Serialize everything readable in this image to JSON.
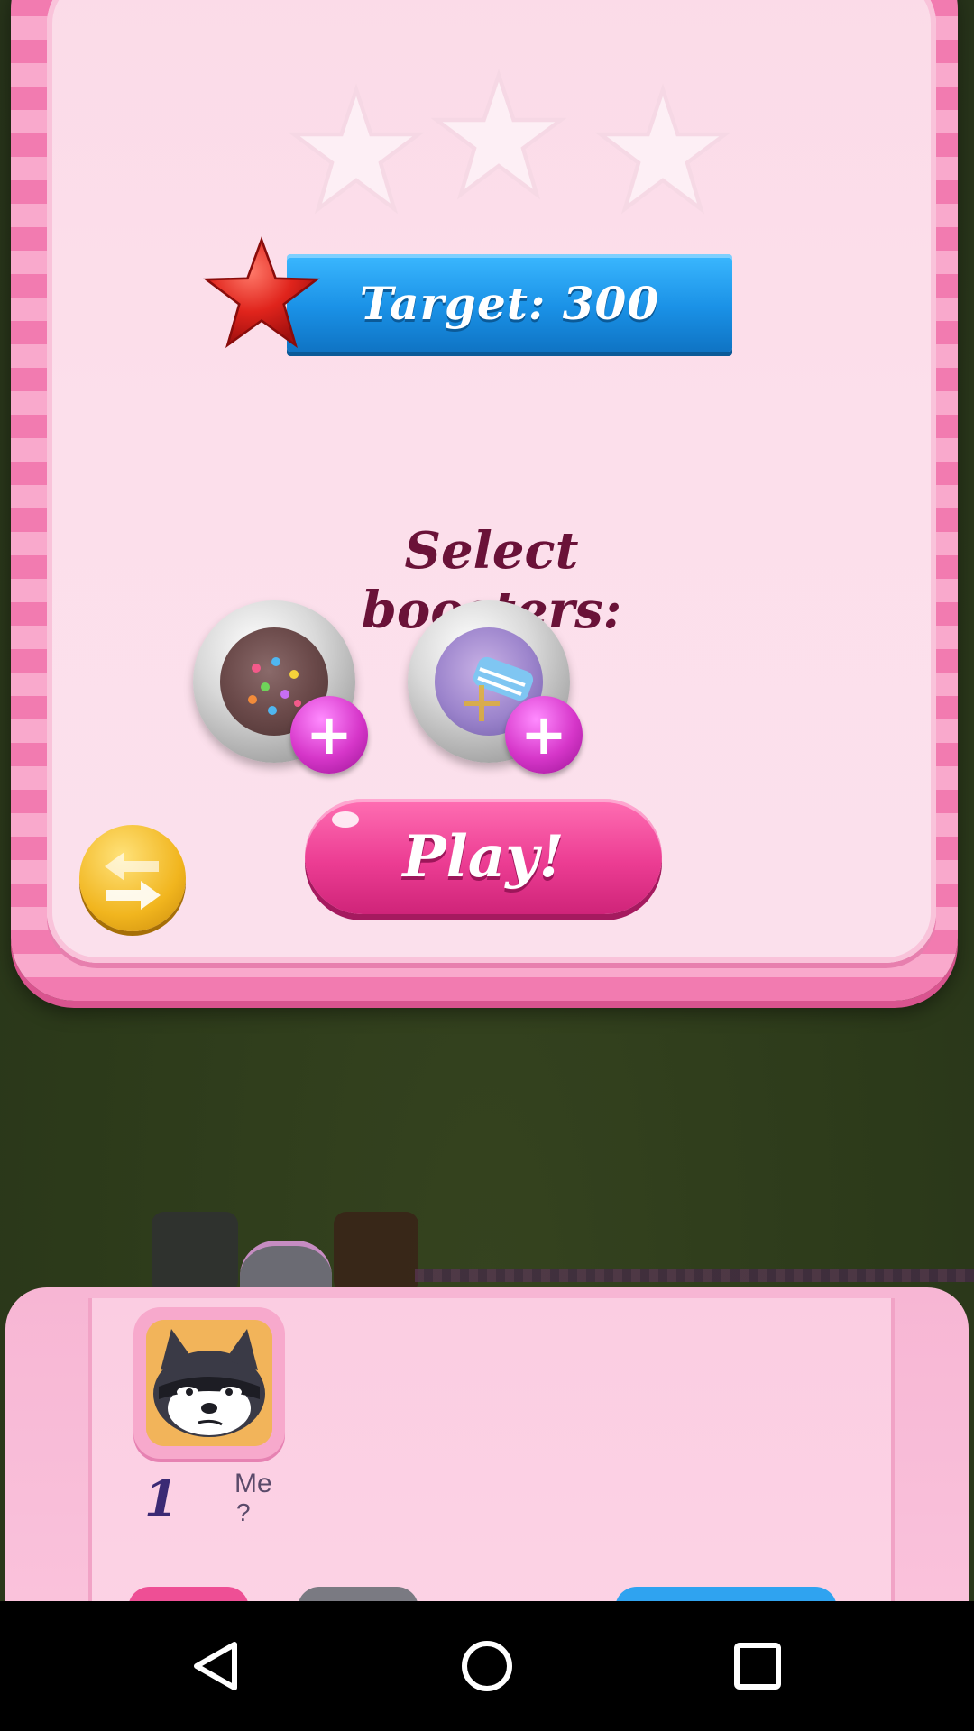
{
  "level_popup": {
    "target_label": "Target: 300",
    "boosters_heading": "Select boosters:",
    "play_label": "Play!",
    "stars_earned": 0,
    "stars_total": 3,
    "boosters": [
      {
        "name": "color-bomb-booster",
        "icon": "plus-icon"
      },
      {
        "name": "striped-wrapped-booster",
        "icon": "plus-icon"
      }
    ],
    "plus_symbol": "+"
  },
  "leaderboard": {
    "rank": "1",
    "player_name": "Me",
    "player_score": "?"
  },
  "navbar": {
    "back_icon": "back-triangle-icon",
    "home_icon": "home-circle-icon",
    "recents_icon": "recents-square-icon"
  },
  "colors": {
    "popup_pink": "#f27bb0",
    "target_blue": "#1a91e6",
    "play_pink": "#ec3d93",
    "heading_maroon": "#6a1238"
  }
}
